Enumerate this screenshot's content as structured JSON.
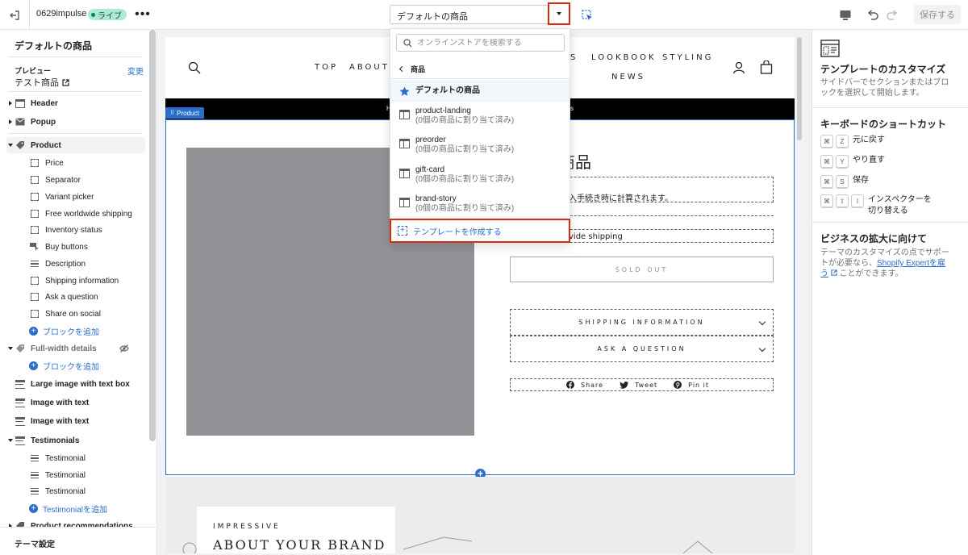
{
  "topbar": {
    "theme_name": "0629impulse",
    "live_badge": "ライブ",
    "more": "•••",
    "template_selected": "デフォルトの商品",
    "save_label": "保存する"
  },
  "sidebar": {
    "title": "デフォルトの商品",
    "preview_label": "プレビュー",
    "preview_change": "変更",
    "preview_product": "テスト商品",
    "items": [
      {
        "label": "Header"
      },
      {
        "label": "Popup"
      },
      {
        "label": "Product"
      },
      {
        "label": "Price"
      },
      {
        "label": "Separator"
      },
      {
        "label": "Variant picker"
      },
      {
        "label": "Free worldwide shipping"
      },
      {
        "label": "Inventory status"
      },
      {
        "label": "Buy buttons"
      },
      {
        "label": "Description"
      },
      {
        "label": "Shipping information"
      },
      {
        "label": "Ask a question"
      },
      {
        "label": "Share on social"
      },
      {
        "label": "ブロックを追加"
      },
      {
        "label": "Full-width details"
      },
      {
        "label": "ブロックを追加"
      },
      {
        "label": "Large image with text box"
      },
      {
        "label": "Image with text"
      },
      {
        "label": "Image with text"
      },
      {
        "label": "Testimonials"
      },
      {
        "label": "Testimonial"
      },
      {
        "label": "Testimonial"
      },
      {
        "label": "Testimonial"
      },
      {
        "label": "Testimonialを追加"
      },
      {
        "label": "Product recommendations"
      }
    ],
    "footer": "テーマ設定"
  },
  "dropdown": {
    "search_placeholder": "オンラインストアを検索する",
    "back_label": "商品",
    "items": [
      {
        "name": "デフォルトの商品",
        "sub": ""
      },
      {
        "name": "product-landing",
        "sub": "(0個の商品に割り当て済み)"
      },
      {
        "name": "preorder",
        "sub": "(0個の商品に割り当て済み)"
      },
      {
        "name": "gift-card",
        "sub": "(0個の商品に割り当て済み)"
      },
      {
        "name": "brand-story",
        "sub": "(0個の商品に割り当て済み)"
      }
    ],
    "create_label": "テンプレートを作成する"
  },
  "preview": {
    "nav": [
      "TOP",
      "ABOUT",
      "S",
      "LOOKBOOK",
      "STYLING",
      "NEWS"
    ],
    "announce_left": "H",
    "announce_right": "s",
    "section_tag": "Product",
    "title_partial": "商品",
    "tax_note_partial": "入手続き時に計算されます。",
    "shipping_partial": "vide shipping",
    "sold_out": "SOLD OUT",
    "shipping_info": "SHIPPING INFORMATION",
    "ask_question": "ASK A QUESTION",
    "share": "Share",
    "tweet": "Tweet",
    "pin": "Pin it",
    "brand_small": "IMPRESSIVE",
    "brand_big": "ABOUT YOUR BRAND"
  },
  "rpanel": {
    "customize_title": "テンプレートのカスタマイズ",
    "customize_desc": "サイドバーでセクションまたはブロックを選択して開始します。",
    "shortcuts_title": "キーボードのショートカット",
    "shortcuts": [
      {
        "keys": [
          "⌘",
          "Z"
        ],
        "label": "元に戻す"
      },
      {
        "keys": [
          "⌘",
          "Y"
        ],
        "label": "やり直す"
      },
      {
        "keys": [
          "⌘",
          "S"
        ],
        "label": "保存"
      },
      {
        "keys": [
          "⌘",
          "⇧",
          "I"
        ],
        "label": "インスペクターを切り替える"
      }
    ],
    "expand_title": "ビジネスの拡大に向けて",
    "expand_desc_1": "テーマのカスタマイズの点でサポートが必要なら、",
    "expand_link": "Shopify Expertを雇う",
    "expand_desc_2": "ことができます。"
  },
  "colors": {
    "accent": "#2c6ecb",
    "highlight": "#d82c0d",
    "live": "#aee9d1"
  }
}
